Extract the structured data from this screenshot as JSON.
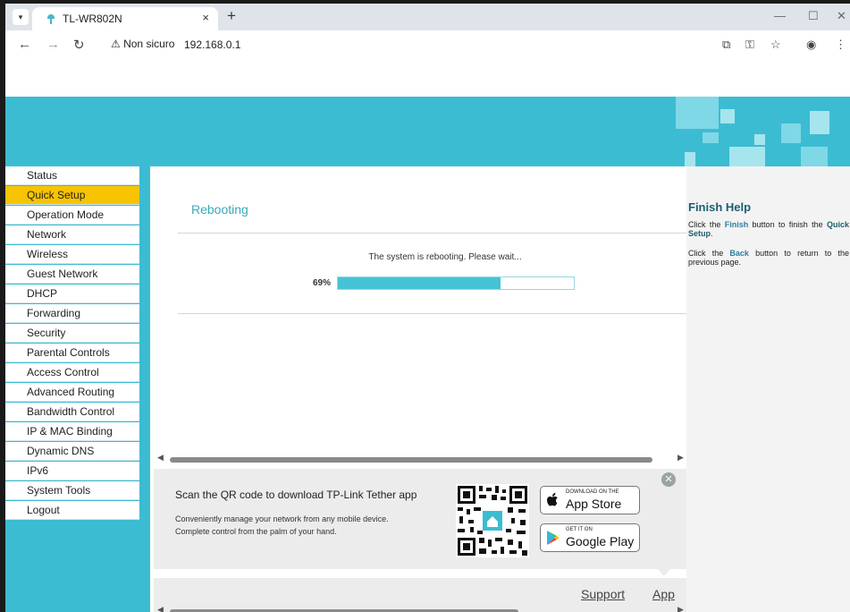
{
  "browser": {
    "tab_title": "TL-WR802N",
    "tab_close": "×",
    "new_tab": "+",
    "security_label": "Non sicuro",
    "url": "192.168.0.1",
    "controls": {
      "minimize": "—",
      "maximize": "☐",
      "close": "✕"
    }
  },
  "sidebar": {
    "items": [
      {
        "label": "Status"
      },
      {
        "label": "Quick Setup"
      },
      {
        "label": "Operation Mode"
      },
      {
        "label": "Network"
      },
      {
        "label": "Wireless"
      },
      {
        "label": "Guest Network"
      },
      {
        "label": "DHCP"
      },
      {
        "label": "Forwarding"
      },
      {
        "label": "Security"
      },
      {
        "label": "Parental Controls"
      },
      {
        "label": "Access Control"
      },
      {
        "label": "Advanced Routing"
      },
      {
        "label": "Bandwidth Control"
      },
      {
        "label": "IP & MAC Binding"
      },
      {
        "label": "Dynamic DNS"
      },
      {
        "label": "IPv6"
      },
      {
        "label": "System Tools"
      },
      {
        "label": "Logout"
      }
    ],
    "active_index": 1
  },
  "main": {
    "title": "Rebooting",
    "message": "The system is rebooting. Please wait...",
    "progress_label": "69%",
    "progress": 0.69
  },
  "banner": {
    "title": "Scan the QR code to download TP-Link Tether app",
    "line1": "Conveniently manage your network from any mobile device.",
    "line2": "Complete control from the palm of your hand.",
    "appstore_small": "DOWNLOAD ON THE",
    "appstore_big": "App Store",
    "googleplay_small": "GET IT ON",
    "googleplay_big": "Google Play"
  },
  "footer": {
    "support": "Support",
    "app": "App"
  },
  "help": {
    "title": "Finish Help",
    "p1_a": "Click the ",
    "p1_kw": "Finish",
    "p1_b": " button to finish the ",
    "p1_c": "Quick Setup",
    "p1_d": ".",
    "p2_a": "Click the ",
    "p2_kw": "Back",
    "p2_b": " button to return to the previous page."
  },
  "colors": {
    "accent": "#3cbcd2",
    "active_menu": "#f8c300",
    "progress_fill": "#45c3d6"
  }
}
